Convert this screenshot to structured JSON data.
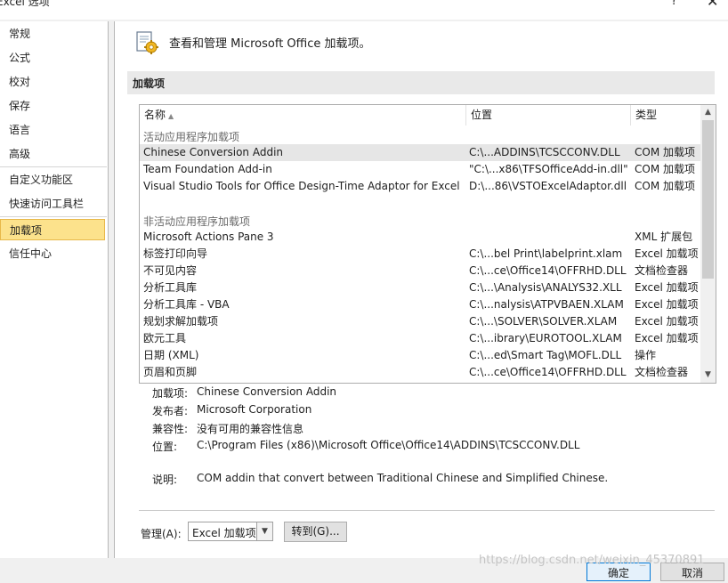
{
  "window": {
    "title": "Excel 选项",
    "help_icon": "?",
    "close_icon": "✕"
  },
  "sidebar": {
    "items": [
      {
        "label": "常规"
      },
      {
        "label": "公式"
      },
      {
        "label": "校对"
      },
      {
        "label": "保存"
      },
      {
        "label": "语言"
      },
      {
        "label": "高级"
      },
      {
        "label": "自定义功能区"
      },
      {
        "label": "快速访问工具栏"
      },
      {
        "label": "加载项",
        "active": true
      },
      {
        "label": "信任中心"
      }
    ]
  },
  "header": {
    "text": "查看和管理 Microsoft Office 加载项。",
    "icon": "addins-gear-icon"
  },
  "section": {
    "title": "加载项"
  },
  "list": {
    "columns": {
      "name": "名称",
      "sort_indicator": "▲",
      "location": "位置",
      "type": "类型"
    },
    "active_group_label": "活动应用程序加载项",
    "active_rows": [
      {
        "name": "Chinese Conversion Addin",
        "location": "C:\\...ADDINS\\TCSCCONV.DLL",
        "type": "COM 加载项",
        "selected": true
      },
      {
        "name": "Team Foundation Add-in",
        "location": "\"C:\\...x86\\TFSOfficeAdd-in.dll\"",
        "type": "COM 加载项"
      },
      {
        "name": "Visual Studio Tools for Office Design-Time Adaptor for Excel",
        "location": "D:\\...86\\VSTOExcelAdaptor.dll",
        "type": "COM 加载项"
      }
    ],
    "inactive_group_label": "非活动应用程序加载项",
    "inactive_rows": [
      {
        "name": "Microsoft Actions Pane 3",
        "location": "",
        "type": "XML 扩展包"
      },
      {
        "name": "标签打印向导",
        "location": "C:\\...bel Print\\labelprint.xlam",
        "type": "Excel 加载项"
      },
      {
        "name": "不可见内容",
        "location": "C:\\...ce\\Office14\\OFFRHD.DLL",
        "type": "文档检查器"
      },
      {
        "name": "分析工具库",
        "location": "C:\\...\\Analysis\\ANALYS32.XLL",
        "type": "Excel 加载项"
      },
      {
        "name": "分析工具库 - VBA",
        "location": "C:\\...nalysis\\ATPVBAEN.XLAM",
        "type": "Excel 加载项"
      },
      {
        "name": "规划求解加载项",
        "location": "C:\\...\\SOLVER\\SOLVER.XLAM",
        "type": "Excel 加载项"
      },
      {
        "name": "欧元工具",
        "location": "C:\\...ibrary\\EUROTOOL.XLAM",
        "type": "Excel 加载项"
      },
      {
        "name": "日期 (XML)",
        "location": "C:\\...ed\\Smart Tag\\MOFL.DLL",
        "type": "操作"
      },
      {
        "name": "页眉和页脚",
        "location": "C:\\...ce\\Office14\\OFFRHD.DLL",
        "type": "文档检查器"
      }
    ],
    "scroll_up": "▲",
    "scroll_down": "▼"
  },
  "details": {
    "addin_label": "加载项:",
    "addin_value": "Chinese Conversion Addin",
    "publisher_label": "发布者:",
    "publisher_value": "Microsoft Corporation",
    "compat_label": "兼容性:",
    "compat_value": "没有可用的兼容性信息",
    "location_label": "位置:",
    "location_value": "C:\\Program Files (x86)\\Microsoft Office\\Office14\\ADDINS\\TCSCCONV.DLL",
    "desc_label": "说明:",
    "desc_value": "COM addin that convert between Traditional Chinese and Simplified Chinese."
  },
  "manage": {
    "label": "管理(A):",
    "select_value": "Excel 加载项",
    "select_arrow": "▼",
    "goto_label": "转到(G)..."
  },
  "footer": {
    "ok_label": "确定",
    "cancel_label": "取消"
  },
  "watermark": "https://blog.csdn.net/weixin_45370891"
}
